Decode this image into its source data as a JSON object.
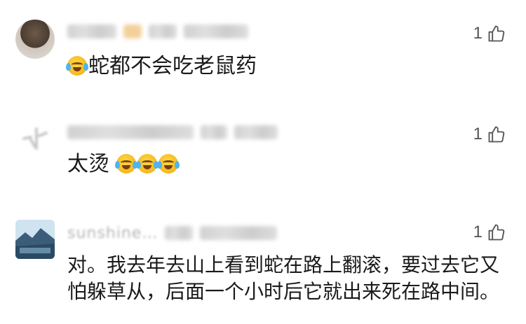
{
  "comments": [
    {
      "meta_blurred": "██ ██ 广东 9小时前",
      "like_count": "1",
      "text": "蛇都不会吃老鼠药",
      "emoji_prefix": "face-with-tears-of-joy-icon"
    },
    {
      "meta_blurred": "A-██████ 广东 1天前",
      "like_count": "1",
      "text": "太烫",
      "emoji_suffix_count": 3
    },
    {
      "username": "sunshine…",
      "meta_blurred": "福建 13小时前",
      "like_count": "1",
      "text_line1": "对。我去年去山上看到蛇在路上翻滚，要过去它又",
      "text_line2": "怕躲草从，后面一个小时后它就出来死在路中间。"
    }
  ],
  "icons": {
    "like": "thumbs-up-icon",
    "emoji": "face-with-tears-of-joy-icon"
  },
  "colors": {
    "text": "#1a1a1a",
    "meta": "#b5b5b5",
    "like": "#555555"
  }
}
